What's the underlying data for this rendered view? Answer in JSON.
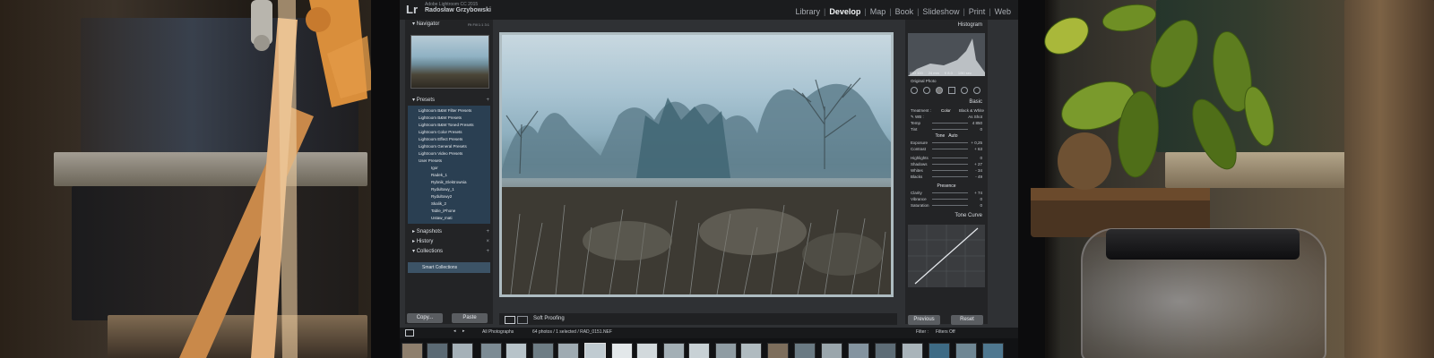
{
  "app": {
    "logo": "Lr",
    "version": "Adobe Lightroom CC 2015",
    "user": "Radosław Grzybowski",
    "modules": [
      "Library",
      "Develop",
      "Map",
      "Book",
      "Slideshow",
      "Print",
      "Web"
    ],
    "active_module": "Develop"
  },
  "left_panel": {
    "navigator": "Navigator",
    "zoom_options": [
      "Fit",
      "Fill",
      "1:1",
      "3:1"
    ],
    "presets": "Presets",
    "preset_items": [
      "Lightroom B&W Filter Presets",
      "Lightroom B&W Presets",
      "Lightroom B&W Toned Presets",
      "Lightroom Color Presets",
      "Lightroom Effect Presets",
      "Lightroom General Presets",
      "Lightroom Video Presets",
      "User Presets"
    ],
    "user_preset_items": [
      "Igor",
      "Radek_1",
      "Rybnik_Elektrownia",
      "Rydultowy_1",
      "Rydultowy2",
      "Skalik_2",
      "Table_iPhone",
      "Ustaw_mati"
    ],
    "snapshots": "Snapshots",
    "history": "History",
    "collections": "Collections",
    "smart_collections": "Smart Collections",
    "copy_button": "Copy...",
    "paste_button": "Paste"
  },
  "toolbar": {
    "soft_proofing": "Soft Proofing"
  },
  "right_panel": {
    "histogram": "Histogram",
    "histogram_info": [
      "ISO 100",
      "24 mm",
      "f/ 8.0",
      "1/50 sec"
    ],
    "original_photo": "Original Photo",
    "basic": "Basic",
    "treatment_label": "Treatment :",
    "treatment_options": [
      "Color",
      "Black & White"
    ],
    "wb_label": "WB :",
    "wb_value": "As Shot",
    "wb_sliders": [
      {
        "label": "Temp",
        "value": "4 850"
      },
      {
        "label": "Tint",
        "value": "0"
      }
    ],
    "tone_label": "Tone",
    "tone_auto": "Auto",
    "tone_sliders": [
      {
        "label": "Exposure",
        "value": "+ 0,25"
      },
      {
        "label": "Contrast",
        "value": "+ 63"
      }
    ],
    "light_sliders": [
      {
        "label": "Highlights",
        "value": "0"
      },
      {
        "label": "Shadows",
        "value": "+ 27"
      },
      {
        "label": "Whites",
        "value": "- 34"
      },
      {
        "label": "Blacks",
        "value": "- 49"
      }
    ],
    "presence_label": "Presence",
    "presence_sliders": [
      {
        "label": "Clarity",
        "value": "+ 74"
      },
      {
        "label": "Vibrance",
        "value": "0"
      },
      {
        "label": "Saturation",
        "value": "0"
      }
    ],
    "tone_curve": "Tone Curve",
    "previous_button": "Previous",
    "reset_button": "Reset"
  },
  "filmstrip": {
    "source": "All Photographs",
    "info": "64 photos / 1 selected / RAD_0151.NEF",
    "filter_label": "Filter :",
    "filter_value": "Filters Off"
  }
}
